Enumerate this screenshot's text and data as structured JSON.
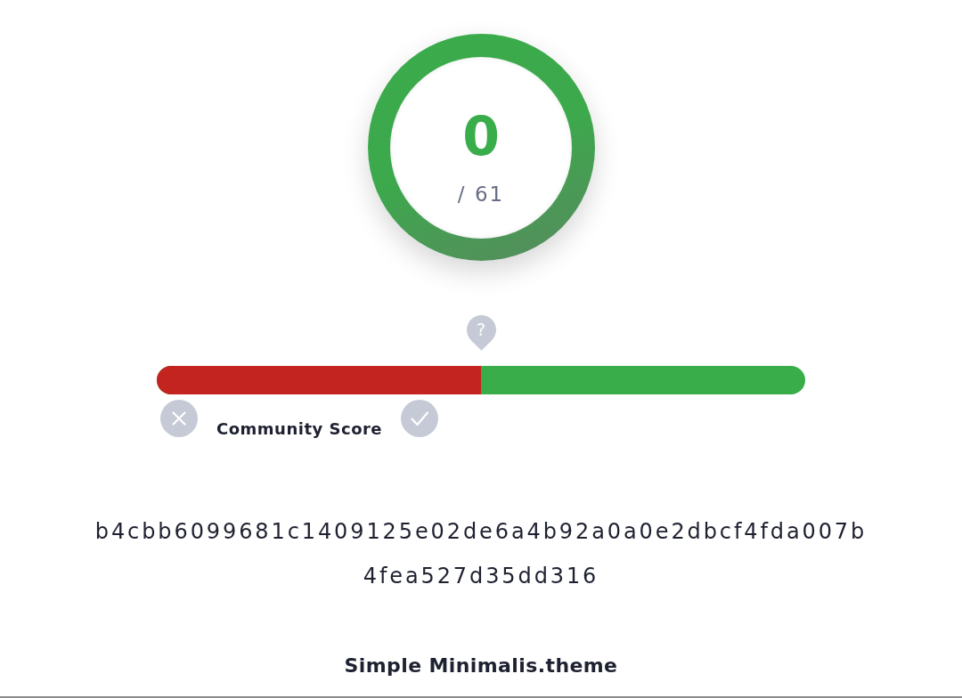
{
  "detection": {
    "malicious": "0",
    "total": "/ 61"
  },
  "community_score": {
    "marker": "?",
    "level": 0.5,
    "label": "Community Score"
  },
  "file": {
    "hash": "b4cbb6099681c1409125e02de6a4b92a0a0e2dbcf4fda007b4fea527d35dd316",
    "name": "Simple Minimalis.theme"
  }
}
